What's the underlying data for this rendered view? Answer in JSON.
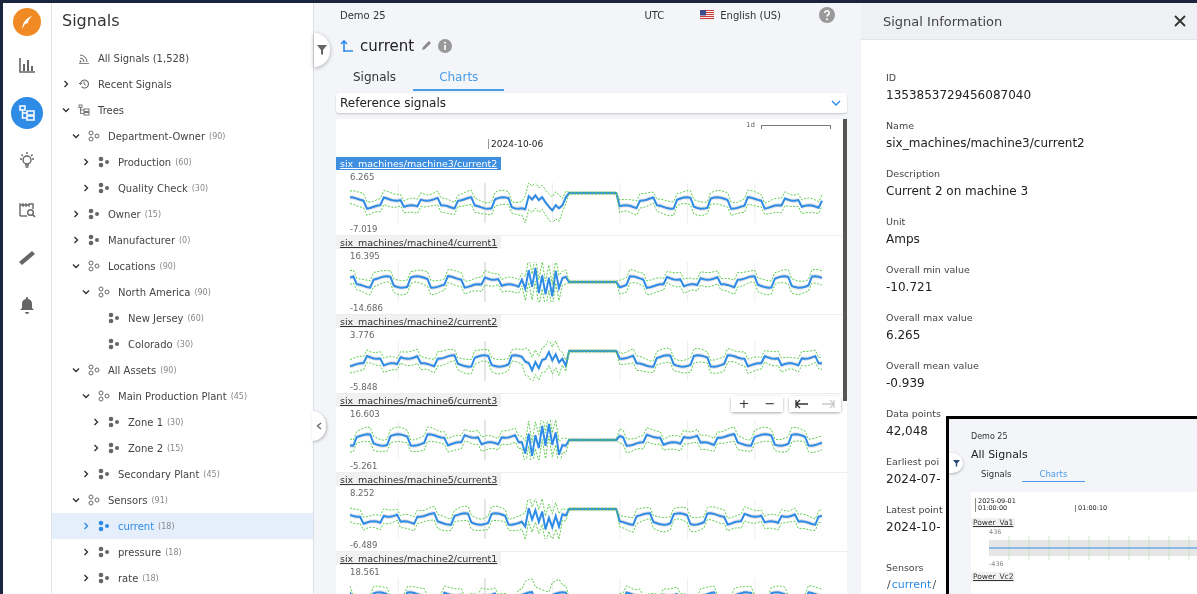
{
  "rail": {
    "items": [
      {
        "kind": "chart",
        "selected": false
      },
      {
        "kind": "tree",
        "selected": true
      },
      {
        "kind": "bulb",
        "selected": false
      },
      {
        "kind": "factory",
        "selected": false
      },
      {
        "kind": "ruler",
        "selected": false
      },
      {
        "kind": "bell",
        "selected": false
      }
    ]
  },
  "tree": {
    "title": "Signals",
    "items": [
      {
        "kind": "feed",
        "label": "All Signals (1,528)",
        "selected": false
      },
      {
        "kind": "history",
        "label": "Recent Signals",
        "expanded": false,
        "selected": false
      },
      {
        "kind": "trees",
        "label": "Trees",
        "expanded": true,
        "selected": false,
        "children": [
          {
            "kind": "group",
            "label": "Department-Owner",
            "count": "(90)",
            "expanded": true,
            "selected": false,
            "children": [
              {
                "kind": "asset",
                "label": "Production",
                "count": "(60)",
                "expanded": false,
                "selected": false
              },
              {
                "kind": "asset",
                "label": "Quality Check",
                "count": "(30)",
                "expanded": false,
                "selected": false
              }
            ]
          },
          {
            "kind": "asset",
            "label": "Owner",
            "count": "(15)",
            "expanded": false,
            "selected": false
          },
          {
            "kind": "asset",
            "label": "Manufacturer",
            "count": "(0)",
            "expanded": false,
            "selected": false
          },
          {
            "kind": "group",
            "label": "Locations",
            "count": "(90)",
            "expanded": true,
            "selected": false,
            "children": [
              {
                "kind": "group",
                "label": "North America",
                "count": "(90)",
                "expanded": true,
                "selected": false,
                "children": [
                  {
                    "kind": "asset",
                    "label": "New Jersey",
                    "count": "(60)",
                    "selected": false
                  },
                  {
                    "kind": "asset",
                    "label": "Colorado",
                    "count": "(30)",
                    "selected": false
                  }
                ]
              }
            ]
          },
          {
            "kind": "group",
            "label": "All Assets",
            "count": "(90)",
            "expanded": true,
            "selected": false,
            "children": [
              {
                "kind": "group",
                "label": "Main Production Plant",
                "count": "(45)",
                "expanded": true,
                "selected": false,
                "children": [
                  {
                    "kind": "asset",
                    "label": "Zone 1",
                    "count": "(30)",
                    "expanded": false,
                    "selected": false
                  },
                  {
                    "kind": "asset",
                    "label": "Zone 2",
                    "count": "(15)",
                    "expanded": false,
                    "selected": false
                  }
                ]
              },
              {
                "kind": "asset",
                "label": "Secondary Plant",
                "count": "(45)",
                "expanded": false,
                "selected": false
              }
            ]
          },
          {
            "kind": "group",
            "label": "Sensors",
            "count": "(91)",
            "expanded": true,
            "selected": false,
            "children": [
              {
                "kind": "asset",
                "label": "current",
                "count": "(18)",
                "expanded": false,
                "selected": true
              },
              {
                "kind": "asset",
                "label": "pressure",
                "count": "(18)",
                "expanded": false,
                "selected": false
              },
              {
                "kind": "asset",
                "label": "rate",
                "count": "(18)",
                "expanded": false,
                "selected": false
              }
            ]
          }
        ]
      }
    ]
  },
  "main": {
    "workspace": "Demo 25",
    "timezone": "UTC",
    "language": "English (US)",
    "title": "current",
    "tabs": [
      {
        "label": "Signals",
        "selected": false
      },
      {
        "label": "Charts",
        "selected": true
      }
    ],
    "dropdown": {
      "value": "Reference signals"
    },
    "scale_label": "1d",
    "date_label": "2024-10-06",
    "charts": [
      {
        "name": "six_machines/machine3/current2",
        "max": "6.265",
        "min": "-7.019",
        "selected": true
      },
      {
        "name": "six_machines/machine4/current1",
        "max": "16.395",
        "min": "-14.686",
        "selected": false
      },
      {
        "name": "six_machines/machine2/current2",
        "max": "3.776",
        "min": "-5.848",
        "selected": false
      },
      {
        "name": "six_machines/machine6/current3",
        "max": "16.603",
        "min": "-5.261",
        "selected": false
      },
      {
        "name": "six_machines/machine5/current3",
        "max": "8.252",
        "min": "-6.489",
        "selected": false
      },
      {
        "name": "six_machines/machine2/current1",
        "max": "18.561",
        "selected": false
      }
    ],
    "zoom_buttons": [
      {
        "label": "+"
      },
      {
        "label": "−"
      }
    ],
    "nav_buttons": [
      {
        "kind": "back",
        "disabled": false
      },
      {
        "kind": "forward",
        "disabled": true
      }
    ]
  },
  "info_panel": {
    "title": "Signal Information",
    "fields": [
      {
        "label": "ID",
        "value": "1353853729456087040"
      },
      {
        "label": "Name",
        "value": "six_machines/machine3/current2"
      },
      {
        "label": "Description",
        "value": "Current 2 on machine 3"
      },
      {
        "label": "Unit",
        "value": "Amps"
      },
      {
        "label": "Overall min value",
        "value": "-10.721"
      },
      {
        "label": "Overall max value",
        "value": "6.265"
      },
      {
        "label": "Overall mean value",
        "value": "-0.939"
      },
      {
        "label": "Data points",
        "value": "42,048"
      },
      {
        "label": "Earliest poi",
        "value": "2024-07-"
      },
      {
        "label": "Latest point",
        "value": "2024-10-"
      }
    ],
    "sensors": {
      "label": "Sensors",
      "path": [
        {
          "kind": "sep",
          "text": "/"
        },
        {
          "kind": "link",
          "text": "current"
        },
        {
          "kind": "sep",
          "text": "/"
        }
      ]
    }
  },
  "inset": {
    "workspace": "Demo 25",
    "title": "All Signals",
    "tabs": [
      {
        "label": "Signals",
        "selected": false
      },
      {
        "label": "Charts",
        "selected": true
      }
    ],
    "timestamps": [
      {
        "date": "2025-09-01",
        "time": "01:00:00"
      },
      {
        "time": "01:00:10"
      }
    ],
    "charts": [
      {
        "name": "Power_Va1",
        "max": "436",
        "min": "-436"
      },
      {
        "name": "Power_Vc2"
      }
    ]
  }
}
